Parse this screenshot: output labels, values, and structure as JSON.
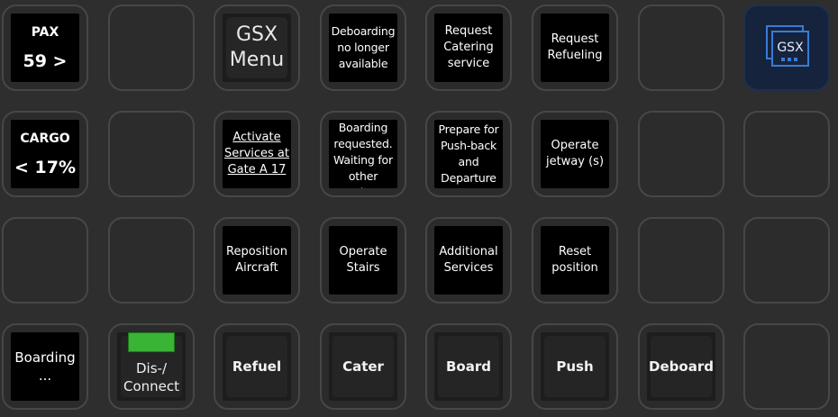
{
  "rows": [
    [
      {
        "kind": "stat",
        "name": "pax-key",
        "label": "PAX",
        "value": "59 >"
      },
      {
        "kind": "blank",
        "name": "blank-key-r1c2"
      },
      {
        "kind": "menu",
        "name": "gsx-menu-key",
        "text": "GSX\nMenu"
      },
      {
        "kind": "text",
        "name": "deboarding-status-key",
        "text": "Deboarding\nno longer\navailable",
        "style": "cond"
      },
      {
        "kind": "text",
        "name": "request-catering-key",
        "text": "Request\nCatering\nservice"
      },
      {
        "kind": "text",
        "name": "request-refueling-key",
        "text": "Request\nRefueling"
      },
      {
        "kind": "blank",
        "name": "blank-key-r1c7"
      },
      {
        "kind": "logo",
        "name": "gsx-logo-key",
        "text": "GSX",
        "icon": "gsx-logo-icon"
      }
    ],
    [
      {
        "kind": "stat",
        "name": "cargo-key",
        "label": "CARGO",
        "value": "< 17%"
      },
      {
        "kind": "blank",
        "name": "blank-key-r2c2"
      },
      {
        "kind": "text",
        "name": "activate-services-key",
        "text": "Activate\nServices at\nGate A 17",
        "style": "under"
      },
      {
        "kind": "text",
        "name": "boarding-requested-key",
        "text": "Boarding\nrequested.\nWaiting for\nother\nservices t",
        "style": "partial"
      },
      {
        "kind": "text",
        "name": "prepare-pushback-key",
        "text": "Prepare for\nPush-back\nand\nDeparture",
        "style": "cond"
      },
      {
        "kind": "text",
        "name": "operate-jetway-key",
        "text": "Operate\njetway (s)"
      },
      {
        "kind": "blank",
        "name": "blank-key-r2c7"
      },
      {
        "kind": "blank",
        "name": "blank-key-r2c8"
      }
    ],
    [
      {
        "kind": "blank",
        "name": "blank-key-r3c1"
      },
      {
        "kind": "blank",
        "name": "blank-key-r3c2"
      },
      {
        "kind": "text",
        "name": "reposition-aircraft-key",
        "text": "Reposition\nAircraft"
      },
      {
        "kind": "text",
        "name": "operate-stairs-key",
        "text": "Operate\nStairs"
      },
      {
        "kind": "text",
        "name": "additional-services-key",
        "text": "Additional\nServices"
      },
      {
        "kind": "text",
        "name": "reset-position-key",
        "text": "Reset\nposition"
      },
      {
        "kind": "blank",
        "name": "blank-key-r3c7"
      },
      {
        "kind": "blank",
        "name": "blank-key-r3c8"
      }
    ],
    [
      {
        "kind": "text",
        "name": "boarding-progress-key",
        "text": "Boarding\n...",
        "style": "big"
      },
      {
        "kind": "connect",
        "name": "connect-key",
        "text": "Dis-/\nConnect",
        "indicator_color": "#39b435"
      },
      {
        "kind": "action",
        "name": "refuel-key",
        "text": "Refuel"
      },
      {
        "kind": "action",
        "name": "cater-key",
        "text": "Cater"
      },
      {
        "kind": "action",
        "name": "board-key",
        "text": "Board"
      },
      {
        "kind": "action",
        "name": "push-key",
        "text": "Push"
      },
      {
        "kind": "action",
        "name": "deboard-key",
        "text": "Deboard"
      },
      {
        "kind": "blank",
        "name": "blank-key-r4c8"
      }
    ]
  ],
  "colors": {
    "background": "#2e2e2e",
    "key_border": "#474747",
    "logo_background": "#15233d",
    "logo_accent": "#3a7bd5",
    "connect_indicator": "#39b435"
  }
}
